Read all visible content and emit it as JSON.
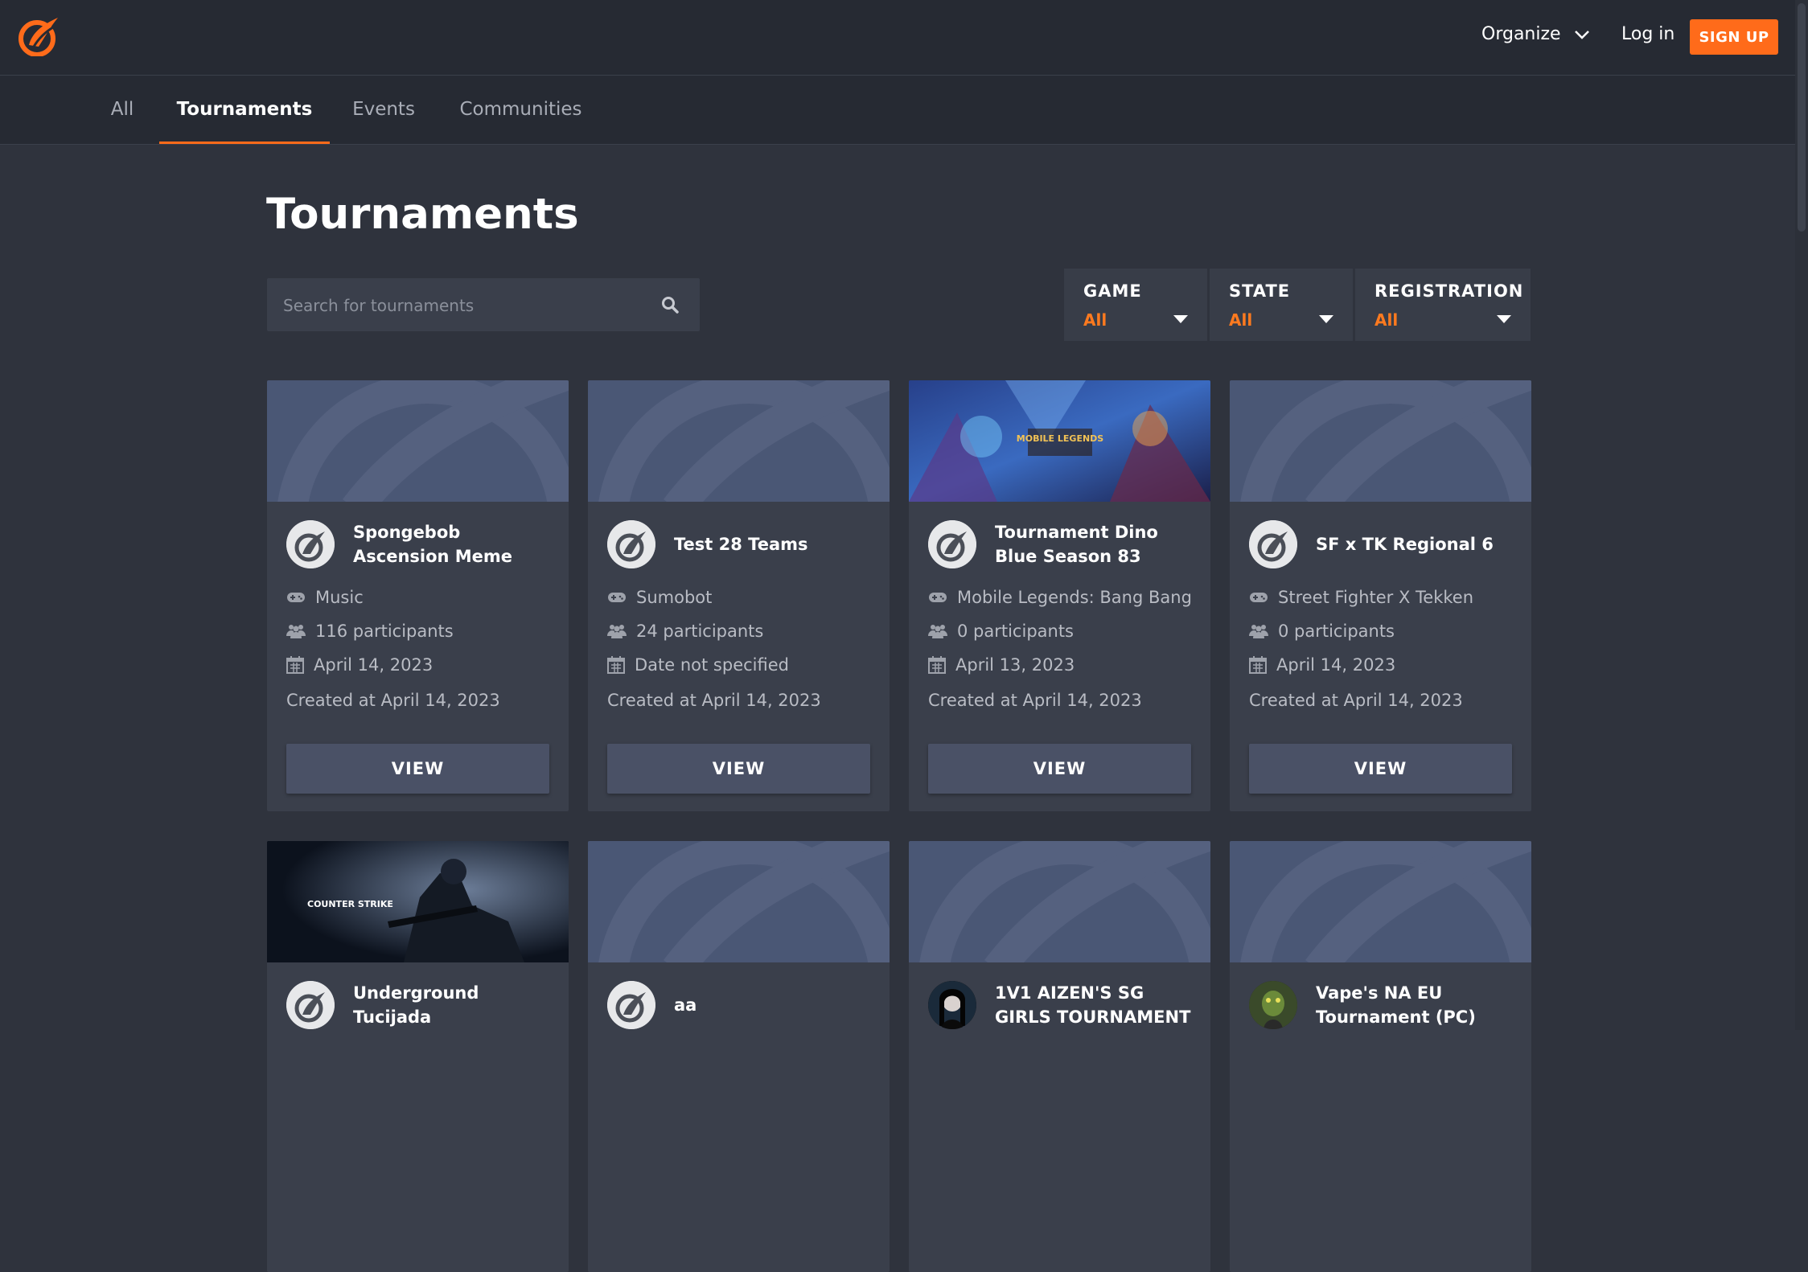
{
  "header": {
    "organize_label": "Organize",
    "login_label": "Log in",
    "signup_label": "SIGN UP"
  },
  "tabs": [
    {
      "label": "All"
    },
    {
      "label": "Tournaments"
    },
    {
      "label": "Events"
    },
    {
      "label": "Communities"
    }
  ],
  "page_title": "Tournaments",
  "search": {
    "placeholder": "Search for tournaments"
  },
  "filters": [
    {
      "label": "GAME",
      "value": "All"
    },
    {
      "label": "STATE",
      "value": "All"
    },
    {
      "label": "REGISTRATION",
      "value": "All"
    }
  ],
  "cards": [
    {
      "title": "Spongebob Ascension Meme",
      "game": "Music",
      "participants": "116 participants",
      "date": "April 14, 2023",
      "created": "Created at April 14, 2023",
      "view_label": "VIEW"
    },
    {
      "title": "Test 28 Teams",
      "game": "Sumobot",
      "participants": "24 participants",
      "date": "Date not specified",
      "created": "Created at April 14, 2023",
      "view_label": "VIEW"
    },
    {
      "title": "Tournament Dino Blue Season 83",
      "game": "Mobile Legends: Bang Bang",
      "participants": "0 participants",
      "date": "April 13, 2023",
      "created": "Created at April 14, 2023",
      "view_label": "VIEW",
      "banner_text": "MOBILE LEGENDS"
    },
    {
      "title": "SF x TK Regional 6",
      "game": "Street Fighter X Tekken",
      "participants": "0 participants",
      "date": "April 14, 2023",
      "created": "Created at April 14, 2023",
      "view_label": "VIEW"
    },
    {
      "title": "Underground Tucijada",
      "banner_text": "COUNTER STRIKE"
    },
    {
      "title": "aa"
    },
    {
      "title": "1V1 AIZEN'S SG GIRLS TOURNAMENT"
    },
    {
      "title": "Vape's NA EU Tournament (PC)"
    }
  ],
  "colors": {
    "accent": "#ff6b1a",
    "background": "#2f333d",
    "header": "#262a33",
    "card": "#3a3f4b",
    "banner_placeholder": "#4a5775"
  }
}
